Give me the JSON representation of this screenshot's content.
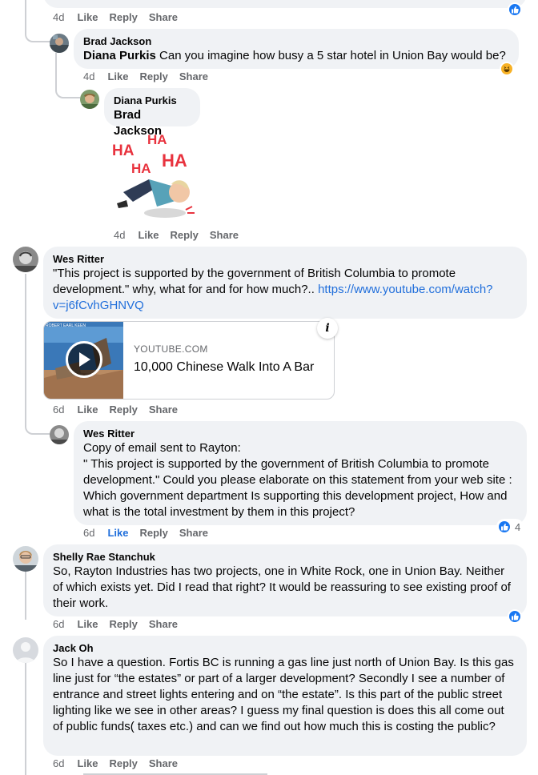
{
  "top": {
    "time": "4d",
    "like": "Like",
    "reply": "Reply",
    "share": "Share"
  },
  "comments": [
    {
      "author": "Brad Jackson",
      "mention": "Diana Purkis",
      "text": " Can you imagine how busy a 5 star hotel in Union Bay would be?",
      "time": "4d",
      "like": "Like",
      "reply": "Reply",
      "share": "Share"
    },
    {
      "author": "Diana Purkis",
      "mention": "Brad Jackson",
      "sticker_text": [
        "HA",
        "HA",
        "HA",
        "HA"
      ],
      "time": "4d",
      "like": "Like",
      "reply": "Reply",
      "share": "Share"
    },
    {
      "author": "Wes Ritter",
      "text": "\"This project is supported by the government of British Columbia to promote development.\" why, what for and for how much?.. ",
      "link": "https://www.youtube.com/watch?v=j6fCvhGHNVQ",
      "preview": {
        "domain": "YOUTUBE.COM",
        "title": "10,000 Chinese Walk Into A Bar",
        "thumb_caption": "ROBERT EARL KEEN"
      },
      "time": "6d",
      "like": "Like",
      "reply": "Reply",
      "share": "Share"
    },
    {
      "author": "Wes Ritter",
      "text": "Copy of email sent to Rayton:\n\" This project is supported by the government of British Columbia to promote development.\" Could you please elaborate on this statement from your web site : Which government department Is supporting this development project, How and what is the total investment by them in this project?",
      "time": "6d",
      "like": "Like",
      "reply": "Reply",
      "share": "Share",
      "reaction_count": "4"
    },
    {
      "author": "Shelly Rae Stanchuk",
      "text": "So, Rayton Industries has two projects, one in White Rock, one in Union Bay. Neither of which exists yet. Did I read that right? It would be reassuring to see existing proof of their work.",
      "time": "6d",
      "like": "Like",
      "reply": "Reply",
      "share": "Share"
    },
    {
      "author": "Jack Oh",
      "text": "So I have a question. Fortis BC is running a gas line just north of Union Bay. Is this gas line just for “the estates” or part of a larger development? Secondly I see a number of entrance and street lights entering and on “the estate”. Is this part of the public street lighting like we see in other areas? I guess my final question is does this all come out of public funds( taxes etc.) and can we find out how much this is costing the public?",
      "time": "6d",
      "like": "Like",
      "reply": "Reply",
      "share": "Share"
    }
  ],
  "colors": {
    "bubble": "#f0f2f5",
    "link": "#216fdb",
    "meta": "#65676b",
    "like_blue": "#1877f2",
    "haha_yellow": "#f7b125",
    "thread_line": "#ced0d4"
  },
  "icons": [
    "like-reaction-icon",
    "haha-reaction-icon",
    "play-icon",
    "info-icon",
    "default-avatar-icon"
  ]
}
